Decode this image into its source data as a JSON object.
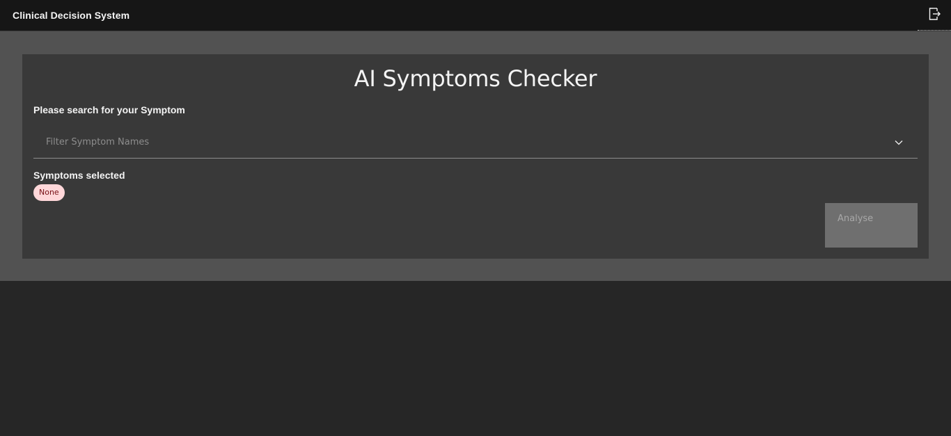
{
  "header": {
    "app_title": "Clinical Decision System",
    "logout_icon": "logout-icon"
  },
  "main": {
    "title": "AI Symptoms Checker",
    "search_label": "Please search for your Symptom",
    "search": {
      "placeholder": "Filter Symptom Names",
      "value": "",
      "dropdown_icon": "chevron-down-icon"
    },
    "selected_label": "Symptoms selected",
    "selected_tag": "None",
    "analyse_button": "Analyse"
  },
  "colors": {
    "header_bg": "#161616",
    "page_bg": "#262626",
    "section_bg": "#525252",
    "card_bg": "#393939",
    "tag_bg": "#ffd7d9",
    "tag_text": "#750e13",
    "button_disabled_bg": "#6f6f6f",
    "button_disabled_text": "#a8a8a8"
  }
}
